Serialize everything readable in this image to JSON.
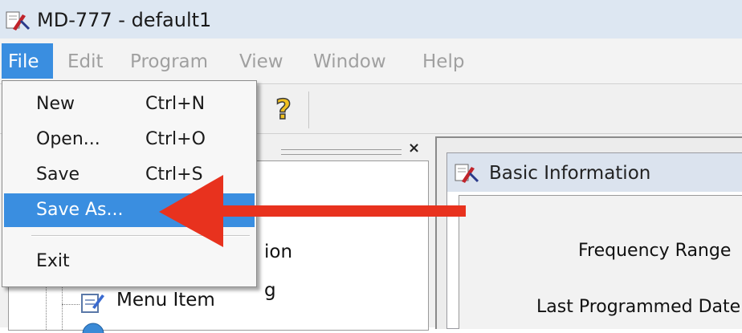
{
  "window": {
    "title": "MD-777 - default1"
  },
  "menubar": {
    "items": [
      {
        "label": "File"
      },
      {
        "label": "Edit"
      },
      {
        "label": "Program"
      },
      {
        "label": "View"
      },
      {
        "label": "Window"
      },
      {
        "label": "Help"
      }
    ]
  },
  "file_menu": {
    "items": [
      {
        "label": "New",
        "shortcut": "Ctrl+N"
      },
      {
        "label": "Open...",
        "shortcut": "Ctrl+O"
      },
      {
        "label": "Save",
        "shortcut": "Ctrl+S"
      },
      {
        "label": "Save As...",
        "shortcut": ""
      },
      {
        "label": "Exit",
        "shortcut": ""
      }
    ],
    "highlighted_item": "Save As..."
  },
  "tree": {
    "partial_labels": [
      "ion",
      "g"
    ],
    "items": [
      {
        "label": "Menu Item",
        "icon": "document-pencil-icon"
      }
    ]
  },
  "basic_info": {
    "title": "Basic Information",
    "fields": [
      {
        "label": "Frequency Range"
      },
      {
        "label": "Last Programmed Date"
      }
    ]
  },
  "annotation": {
    "arrow_color": "#e8321e"
  },
  "colors": {
    "highlight": "#3a8ee0",
    "titlebar": "#dde7f2"
  }
}
